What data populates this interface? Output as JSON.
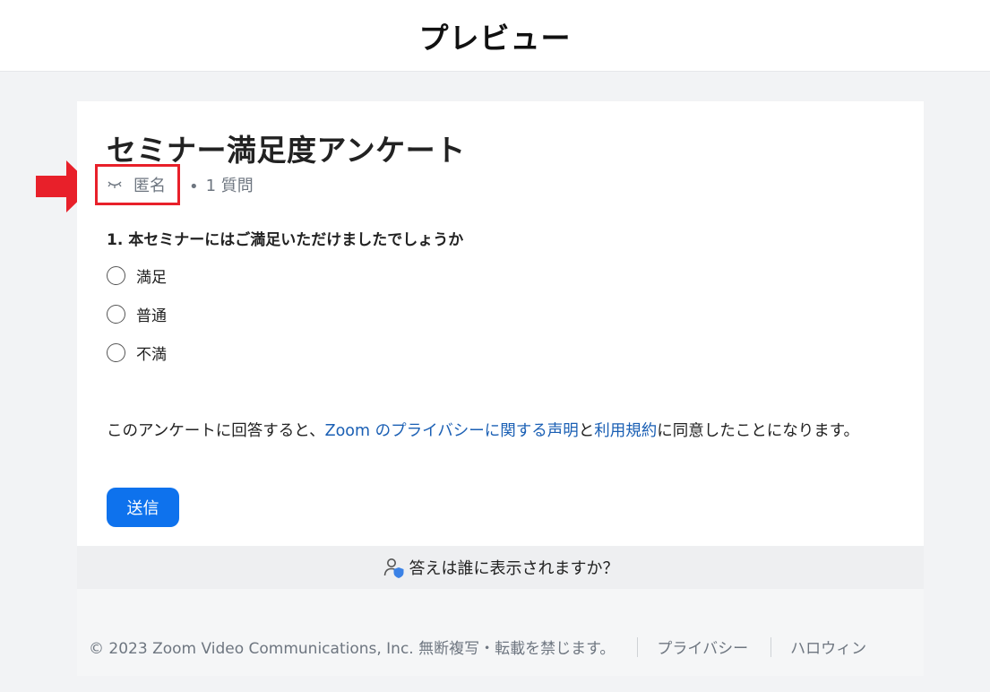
{
  "header": {
    "title": "プレビュー"
  },
  "survey": {
    "title": "セミナー満足度アンケート",
    "anonymous_label": "匿名",
    "separator": "•",
    "question_count": "1 質問",
    "question": "1. 本セミナーにはご満足いただけましたでしょうか",
    "options": [
      "満足",
      "普通",
      "不満"
    ],
    "consent": {
      "prefix": "このアンケートに回答すると、",
      "privacy_link": "Zoom のプライバシーに関する声明",
      "middle": "と",
      "terms_link": "利用規約",
      "suffix": "に同意したことになります。"
    },
    "submit_label": "送信"
  },
  "who_can_see": {
    "text": "答えは誰に表示されますか？"
  },
  "footer": {
    "copyright": "© 2023 Zoom Video Communications, Inc. 無断複写・転載を禁じます。",
    "links": [
      "プライバシー",
      "ハロウィン"
    ]
  },
  "colors": {
    "accent": "#0e72ed",
    "link": "#1a5fb4",
    "highlight": "#e8202a"
  },
  "icons": {
    "anonymous": "eye-closed-icon",
    "who_can_see": "user-shield-icon",
    "annotation": "arrow-right-icon"
  }
}
